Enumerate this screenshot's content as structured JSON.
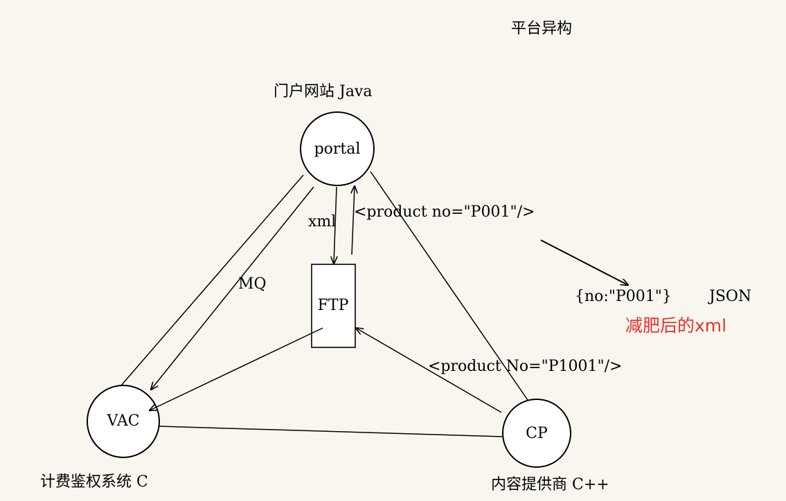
{
  "title": "平台异构",
  "nodes": {
    "portal": {
      "label": "portal",
      "caption": "门户网站 Java"
    },
    "ftp": {
      "label": "FTP"
    },
    "vac": {
      "label": "VAC",
      "caption": "计费鉴权系统 C"
    },
    "cp": {
      "label": "CP",
      "caption": "内容提供商 C++"
    }
  },
  "edge_labels": {
    "xml": "xml",
    "mq": "MQ",
    "portal_xml": "<product no=\"P001\"/>",
    "cp_xml": "<product No=\"P1001\"/>"
  },
  "json_note": {
    "json_text": "{no:\"P001\"}",
    "json_label": "JSON",
    "slim_note": "减肥后的xml",
    "slim_color": "#e8322b"
  }
}
